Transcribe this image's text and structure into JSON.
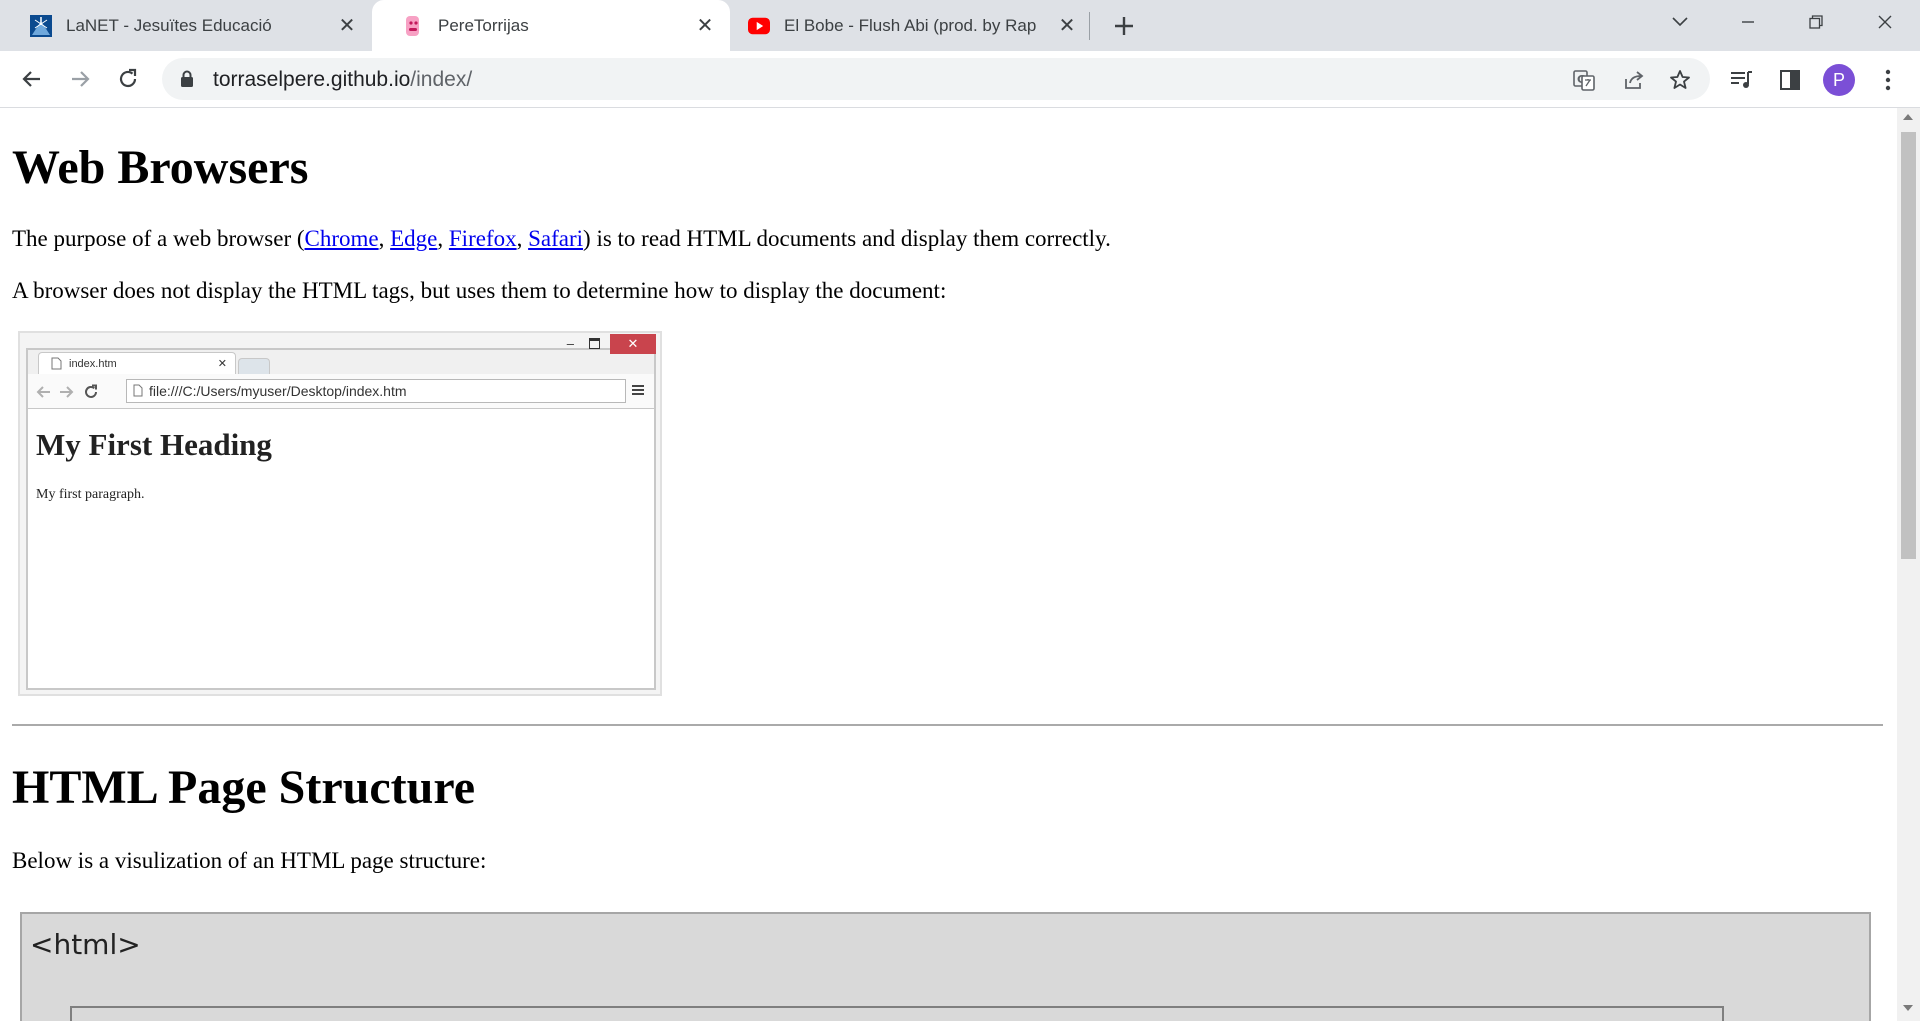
{
  "tabs": [
    {
      "title": "LaNET - Jesuïtes Educació",
      "icon": "lanet-favicon"
    },
    {
      "title": "PereTorrijas",
      "icon": "pere-favicon",
      "active": true
    },
    {
      "title": "El Bobe - Flush Abi (prod. by Rap",
      "icon": "youtube-favicon"
    }
  ],
  "omnibox": {
    "host": "torraselpere.github.io",
    "path": "/index/"
  },
  "profile": {
    "initial": "P",
    "color": "#7b4fd6"
  },
  "page": {
    "section1": {
      "heading": "Web Browsers",
      "p1_before": "The purpose of a web browser (",
      "links": [
        "Chrome",
        "Edge",
        "Firefox",
        "Safari"
      ],
      "p1_after": ") is to read HTML documents and display them correctly.",
      "p2": "A browser does not display the HTML tags, but uses them to determine how to display the document:"
    },
    "illustration": {
      "tab": "index.htm",
      "address": "file:///C:/Users/myuser/Desktop/index.htm",
      "heading": "My First Heading",
      "paragraph": "My first paragraph."
    },
    "section2": {
      "heading": "HTML Page Structure",
      "p1": "Below is a visulization of an HTML page structure:",
      "diagram_tag": "<html>"
    }
  }
}
